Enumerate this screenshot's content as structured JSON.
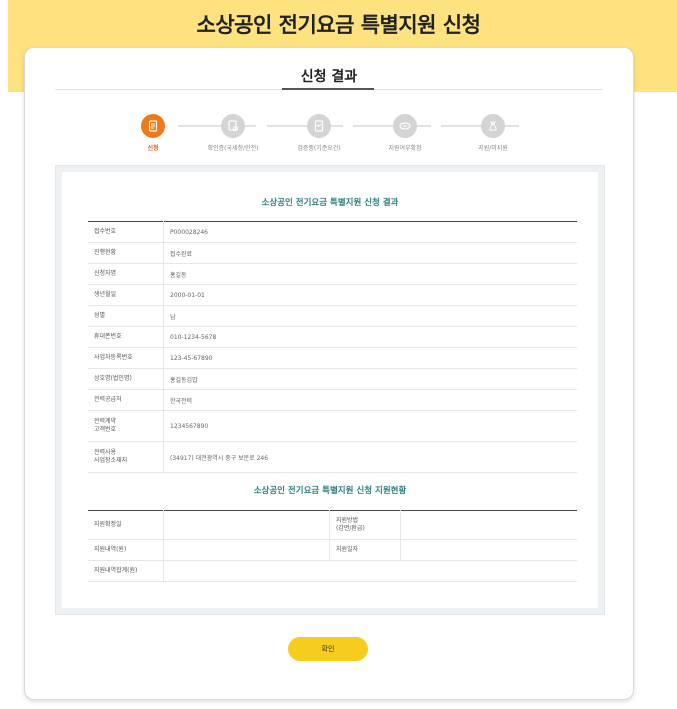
{
  "header": {
    "title": "소상공인 전기요금 특별지원 신청"
  },
  "card": {
    "title": "신청 결과"
  },
  "steps": [
    {
      "label": "신청",
      "icon": "document-icon",
      "active": true
    },
    {
      "label": "확인증(국세청/한전)",
      "icon": "verify-document-icon",
      "active": false
    },
    {
      "label": "검증중(기준요건)",
      "icon": "review-document-icon",
      "active": false
    },
    {
      "label": "지원여부확정",
      "icon": "coin-icon",
      "active": false
    },
    {
      "label": "지원/미지원",
      "icon": "money-bag-icon",
      "active": false
    }
  ],
  "result": {
    "title": "소상공인 전기요금 특별지원 신청 결과",
    "rows": [
      {
        "label": "접수번호",
        "value": "P000028246"
      },
      {
        "label": "진행현황",
        "value": "접수완료"
      },
      {
        "label": "신청자명",
        "value": "홍길동"
      },
      {
        "label": "생년월일",
        "value": "2000-01-01"
      },
      {
        "label": "성별",
        "value": "남"
      },
      {
        "label": "휴대폰번호",
        "value": "010-1234-5678"
      },
      {
        "label": "사업자등록번호",
        "value": "123-45-67890"
      },
      {
        "label": "상호명(법인명)",
        "value": "홍길동김밥"
      },
      {
        "label": "전력공급처",
        "value": "한국전력"
      },
      {
        "label": "전력계약\n고객번호",
        "value": "1234567890"
      },
      {
        "label": "전력사용\n사업장소재지",
        "value": "(34917) 대전광역시 중구 보문로 246"
      }
    ]
  },
  "support": {
    "title": "소상공인 전기요금 특별지원 신청 지원현황",
    "confirm_date_label": "지원확정일",
    "confirm_date_value": "",
    "method_label": "지원방법\n(감면/환급)",
    "method_value": "",
    "amount_label": "지원내역(원)",
    "amount_value": "",
    "support_date_label": "지원일자",
    "support_date_value": "",
    "total_label": "지원내역합계(원)",
    "total_value": ""
  },
  "button": {
    "confirm_label": "확인"
  },
  "colors": {
    "accent": "#f07a1a",
    "header": "#fde27f",
    "button": "#f6cd1e",
    "section_title": "#2f7f82"
  }
}
